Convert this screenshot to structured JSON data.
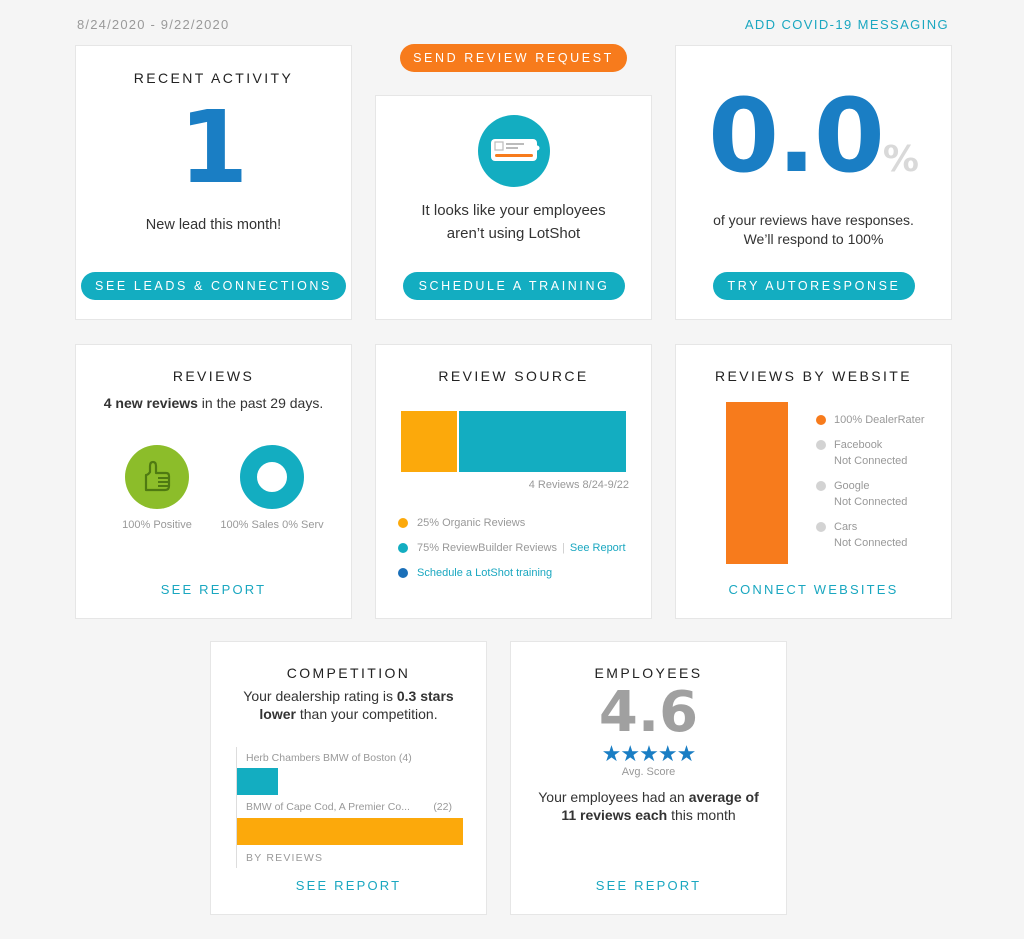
{
  "header": {
    "date_range": "8/24/2020 - 9/22/2020",
    "covid_link": "ADD COVID-19 MESSAGING",
    "send_review_request": "SEND REVIEW REQUEST"
  },
  "colors": {
    "teal": "#13adc1",
    "orange": "#f77b1c",
    "amber": "#fca90b",
    "blue": "#1a7ec4",
    "green": "#8cbd2a",
    "grey_dot": "#d3d3d3"
  },
  "recent_activity": {
    "title": "RECENT ACTIVITY",
    "count": "1",
    "caption": "New lead this month!",
    "button": "SEE LEADS & CONNECTIONS"
  },
  "lotshot": {
    "icon": "lotshot-card-icon",
    "line1": "It looks like your employees",
    "line2": "aren’t using LotShot",
    "button": "SCHEDULE A TRAINING"
  },
  "responses": {
    "value": "0.0",
    "unit": "%",
    "line1": "of your reviews have responses.",
    "line2": "We’ll respond to 100%",
    "button": "TRY AUTORESPONSE"
  },
  "reviews": {
    "title": "REVIEWS",
    "summary_bold": "4 new reviews",
    "summary_rest": " in the past 29 days.",
    "positive_label": "100% Positive",
    "sales_label": "100% Sales 0% Serv",
    "positive_pct": 100,
    "sales_pct": 100,
    "link": "SEE REPORT"
  },
  "review_source": {
    "title": "REVIEW SOURCE",
    "bar_caption": "4 Reviews 8/24-9/22",
    "segments": [
      {
        "label": "25% Organic Reviews",
        "pct": 25,
        "color": "#fca90b"
      },
      {
        "label": "75% ReviewBuilder Reviews",
        "pct": 75,
        "color": "#13adc1"
      }
    ],
    "see_report": "See Report",
    "separator": "|",
    "schedule_link": "Schedule a LotShot training"
  },
  "reviews_by_website": {
    "title": "REVIEWS BY WEBSITE",
    "bar_pct": 100,
    "legend": [
      {
        "name": "100% DealerRater",
        "status": "",
        "color": "#f77b1c"
      },
      {
        "name": "Facebook",
        "status": "Not Connected",
        "color": "#d3d3d3"
      },
      {
        "name": "Google",
        "status": "Not Connected",
        "color": "#d3d3d3"
      },
      {
        "name": "Cars",
        "status": "Not Connected",
        "color": "#d3d3d3"
      }
    ],
    "link": "CONNECT WEBSITES"
  },
  "competition": {
    "title": "COMPETITION",
    "text_1": "Your dealership rating is ",
    "text_bold_1": "0.3 stars",
    "text_bold_2": "lower",
    "text_2": " than your competition.",
    "bars": [
      {
        "name": "Herb Chambers BMW of Boston",
        "count_label": "(4)",
        "value": 4,
        "color": "#13adc1"
      },
      {
        "name": "BMW of Cape Cod, A Premier Co...",
        "count_label": "(22)",
        "value": 22,
        "color": "#fca90b"
      }
    ],
    "axis_label": "BY REVIEWS",
    "link": "SEE REPORT"
  },
  "employees": {
    "title": "EMPLOYEES",
    "score": "4.6",
    "stars": 5,
    "score_label": "Avg. Score",
    "text_1": "Your employees had an ",
    "text_bold_1": "average of",
    "text_bold_2": "11 reviews each",
    "text_2": " this month",
    "link": "SEE REPORT"
  }
}
